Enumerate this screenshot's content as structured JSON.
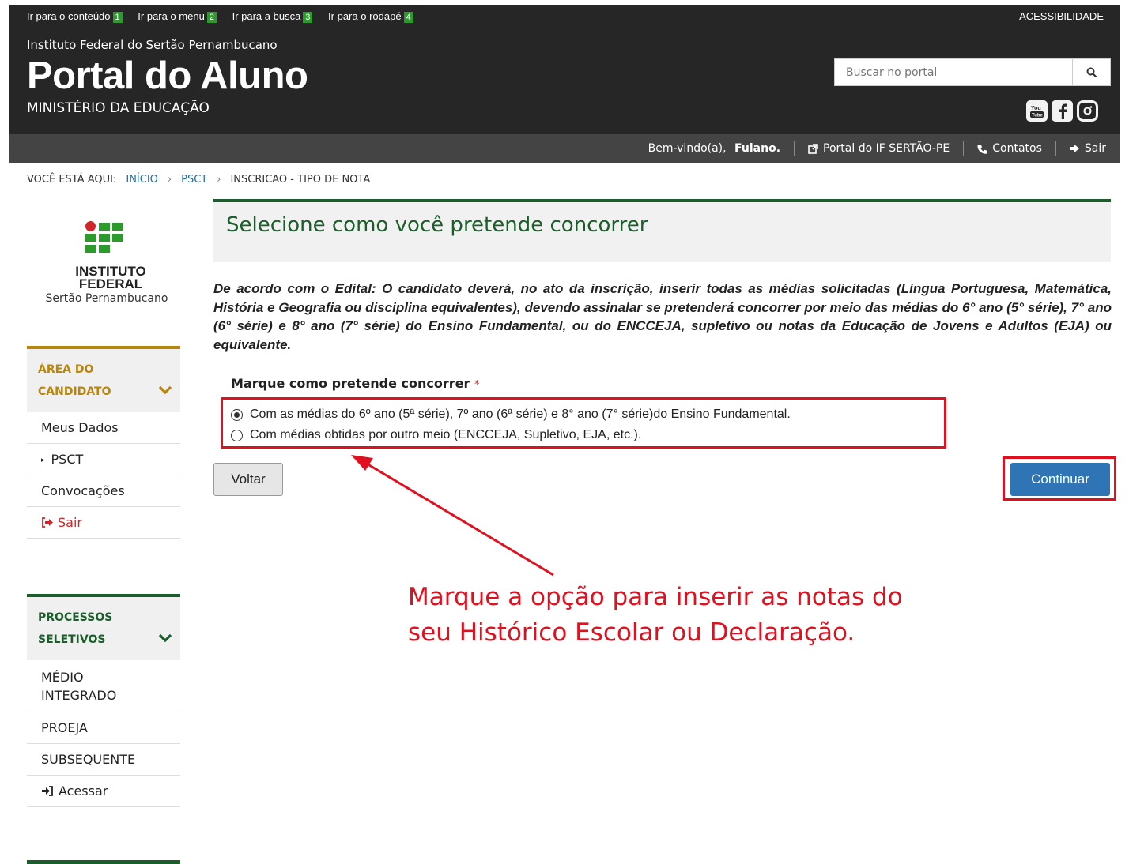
{
  "skip_links": [
    {
      "label": "Ir para o conteúdo",
      "key": "1"
    },
    {
      "label": "Ir para o menu",
      "key": "2"
    },
    {
      "label": "Ir para a busca",
      "key": "3"
    },
    {
      "label": "Ir para o rodapé",
      "key": "4"
    }
  ],
  "accessibility_label": "ACESSIBILIDADE",
  "header": {
    "institution": "Instituto Federal do Sertão Pernambucano",
    "title": "Portal do Aluno",
    "ministry": "MINISTÉRIO DA EDUCAÇÃO",
    "search_placeholder": "Buscar no portal",
    "social_icons": [
      "youtube-icon",
      "facebook-icon",
      "instagram-icon"
    ]
  },
  "userbar": {
    "welcome_prefix": "Bem-vindo(a), ",
    "user_name": "Fulano.",
    "portal_link": "Portal do IF SERTÃO-PE",
    "contacts": "Contatos",
    "logout": "Sair"
  },
  "breadcrumb": {
    "prefix": "VOCÊ ESTÁ AQUI:",
    "items": [
      "INÍCIO",
      "PSCT",
      "INSCRICAO - TIPO DE NOTA"
    ]
  },
  "logo": {
    "line1": "INSTITUTO",
    "line2": "FEDERAL",
    "line3": "Sertão Pernambucano"
  },
  "sidebar": {
    "candidate_area": {
      "title_line1": "ÁREA DO",
      "title_line2": "CANDIDATO",
      "accent": "#b8860b",
      "items": [
        "Meus Dados",
        "PSCT",
        "Convocações",
        "Sair"
      ]
    },
    "processes": {
      "title_line1": "PROCESSOS",
      "title_line2": "SELETIVOS",
      "accent": "#1c5e2b",
      "items": [
        "MÉDIO INTEGRADO",
        "PROEJA",
        "SUBSEQUENTE",
        "Acessar"
      ]
    }
  },
  "main": {
    "title": "Selecione como você pretende concorrer",
    "edital_text": "De acordo com o Edital: O candidato deverá, no ato da inscrição, inserir todas as médias solicitadas (Língua Portuguesa, Matemática, História e Geografia ou disciplina equivalentes), devendo assinalar se pretenderá concorrer por meio das médias do 6° ano (5° série), 7° ano (6° série) e 8° ano (7° série) do Ensino Fundamental, ou do ENCCEJA, supletivo ou notas da Educação de Jovens e Adultos (EJA) ou equivalente.",
    "field_label": "Marque como pretende concorrer",
    "required_mark": "*",
    "options": [
      {
        "label": "Com as médias do 6º ano (5ª série), 7º ano (6ª série) e 8° ano (7° série)do Ensino Fundamental.",
        "checked": true
      },
      {
        "label": "Com médias obtidas por outro meio (ENCCEJA, Supletivo, EJA, etc.).",
        "checked": false
      }
    ],
    "back_button": "Voltar",
    "continue_button": "Continuar"
  },
  "annotation": {
    "line1": "Marque a opção para inserir as notas do",
    "line2": "seu Histórico Escolar ou Declaração.",
    "color": "#e0101e"
  }
}
